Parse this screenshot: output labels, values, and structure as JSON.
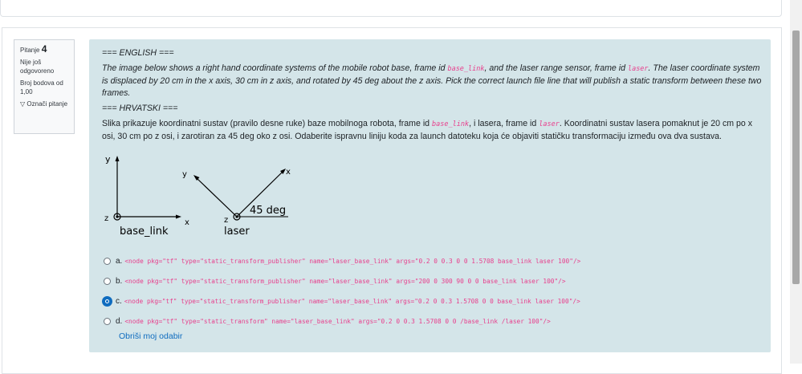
{
  "info": {
    "question_label": "Pitanje",
    "question_number": "4",
    "status": "Nije još odgovoreno",
    "points": "Broj bodova od 1,00",
    "flag_label": "Označi pitanje"
  },
  "question": {
    "en_header": "=== ENGLISH ===",
    "en_text_1": "The image below shows a right hand coordinate systems of the mobile robot base, frame id ",
    "en_frame_base": "base_link",
    "en_text_2": ", and the laser range sensor, frame id ",
    "en_frame_laser": "laser",
    "en_text_3": ". The laser coordinate system is displaced by 20 cm in the x axis, 30 cm in z axis, and rotated by 45 deg about the z axis. Pick the correct launch file line that will publish a static transform between these two frames.",
    "hr_header": "=== HRVATSKI ===",
    "hr_text_1": "Slika prikazuje koordinatni sustav (pravilo desne ruke) baze mobilnoga robota, frame id ",
    "hr_frame_base": "base_link",
    "hr_text_2": ", i lasera, frame id ",
    "hr_frame_laser": "laser",
    "hr_text_3": ". Koordinatni sustav lasera pomaknut je 20 cm po x osi, 30 cm po z osi, i zarotiran za 45 deg oko z osi. Odaberite ispravnu liniju koda za launch datoteku koja će objaviti statičku transformaciju između ova dva sustava."
  },
  "diagram": {
    "y_label": "y",
    "x_label": "x",
    "z_label_base": "z",
    "base_caption": "base_link",
    "y_label_laser": "y",
    "x_label_laser": "x",
    "z_label_laser": "z",
    "angle_label": "45 deg",
    "laser_caption": "laser"
  },
  "answers": [
    {
      "letter": "a.",
      "code": "<node pkg=\"tf\" type=\"static_transform_publisher\" name=\"laser_base_link\" args=\"0.2 0 0.3 0 0 1.5708 base_link laser 100\"/>",
      "selected": false
    },
    {
      "letter": "b.",
      "code": "<node pkg=\"tf\" type=\"static_transform_publisher\" name=\"laser_base_link\" args=\"200 0 300 90 0 0 base_link laser 100\"/>",
      "selected": false
    },
    {
      "letter": "c.",
      "code": "<node pkg=\"tf\" type=\"static_transform_publisher\" name=\"laser_base_link\" args=\"0.2 0 0.3 1.5708 0 0 base_link laser 100\"/>",
      "selected": true
    },
    {
      "letter": "d.",
      "code": "<node pkg=\"tf\" type=\"static_transform\" name=\"laser_base_link\" args=\"0.2 0 0.3 1.5708 0 0 /base_link /laser 100\"/>",
      "selected": false
    }
  ],
  "clear_label": "Obriši moj odabir"
}
